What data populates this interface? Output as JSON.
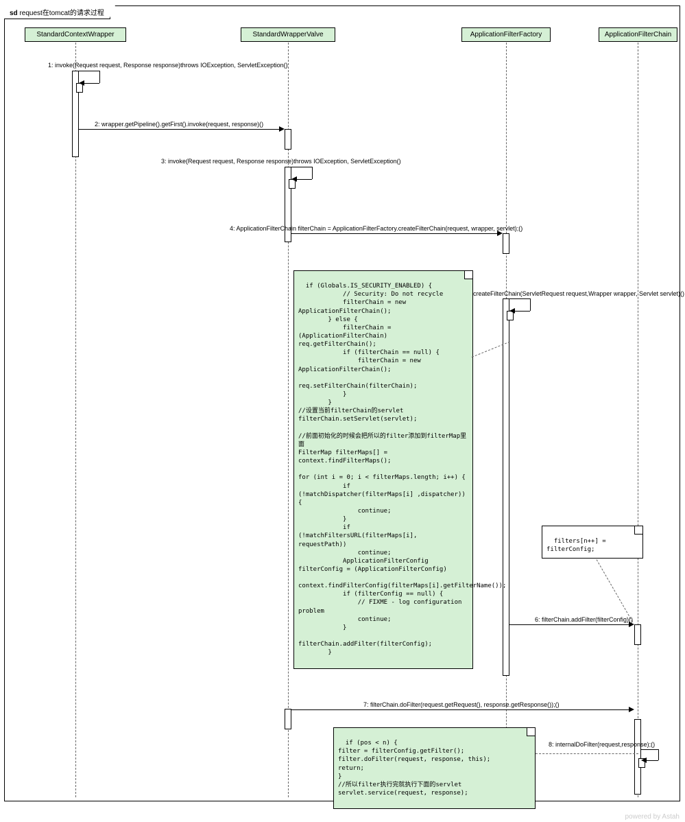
{
  "title_prefix": "sd",
  "title_text": "request在tomcat的请求过程",
  "lifelines": {
    "l1": "StandardContextWrapper",
    "l2": "StandardWrapperValve",
    "l3": "ApplicationFilterFactory",
    "l4": "ApplicationFilterChain"
  },
  "messages": {
    "m1": "1: invoke(Request request, Response response)throws IOException, ServletException()",
    "m2": "2: wrapper.getPipeline().getFirst().invoke(request, response)()",
    "m3": "3: invoke(Request request, Response response)throws IOException, ServletException()",
    "m4": "4: ApplicationFilterChain filterChain = ApplicationFilterFactory.createFilterChain(request, wrapper, servlet);()",
    "m5": "5: createFilterChain(ServletRequest request,Wrapper wrapper, Servlet servlet)()",
    "m6": "6: filterChain.addFilter(filterConfig)()",
    "m7": "7: filterChain.doFilter(request.getRequest(), response.getResponse());()",
    "m8": "8: internalDoFilter(request,response);()"
  },
  "notes": {
    "note1": "if (Globals.IS_SECURITY_ENABLED) {\n            // Security: Do not recycle\n            filterChain = new ApplicationFilterChain();\n        } else {\n            filterChain = (ApplicationFilterChain) req.getFilterChain();\n            if (filterChain == null) {\n                filterChain = new ApplicationFilterChain();\n                req.setFilterChain(filterChain);\n            }\n        }\n//设置当前filterChain的servlet\nfilterChain.setServlet(servlet);\n\n//前面初始化的时候会把所以的filter添加到filterMap里面\nFilterMap filterMaps[] = context.findFilterMaps();\n\nfor (int i = 0; i < filterMaps.length; i++) {\n            if (!matchDispatcher(filterMaps[i] ,dispatcher)) {\n                continue;\n            }\n            if (!matchFiltersURL(filterMaps[i], requestPath))\n                continue;\n            ApplicationFilterConfig filterConfig = (ApplicationFilterConfig)\n                context.findFilterConfig(filterMaps[i].getFilterName());\n            if (filterConfig == null) {\n                // FIXME - log configuration problem\n                continue;\n            }\n            filterChain.addFilter(filterConfig);\n        }",
    "note2": "filters[n++] = filterConfig;",
    "note3": "if (pos < n) {\nfilter = filterConfig.getFilter();\nfilter.doFilter(request, response, this);\nreturn;\n}\n//所以filter执行完就执行下面的servlet\nservlet.service(request, response);"
  },
  "watermark": "powered by Astah"
}
